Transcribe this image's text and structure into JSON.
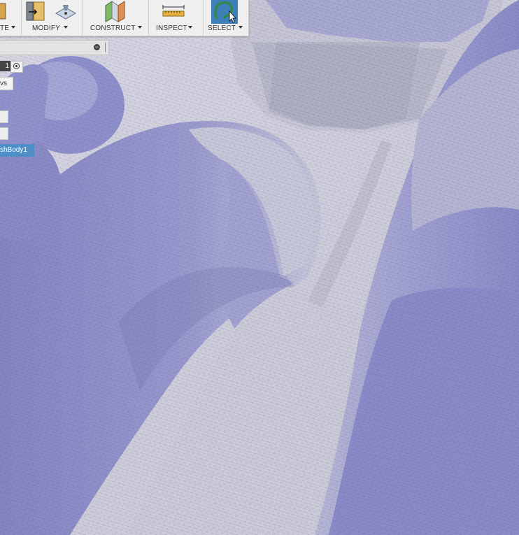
{
  "toolbar": {
    "groups": [
      {
        "label": "TE",
        "id": "create"
      },
      {
        "label": "MODIFY",
        "id": "modify"
      },
      {
        "label": "CONSTRUCT",
        "id": "construct"
      },
      {
        "label": "INSPECT",
        "id": "inspect"
      },
      {
        "label": "SELECT",
        "id": "select"
      }
    ]
  },
  "browser": {
    "row_number": "1",
    "views_label": "vs",
    "mesh_body_label": "shBody1"
  },
  "icons": [
    "modify-icon",
    "fill-icon",
    "construct-plane-icon",
    "measure-icon",
    "select-lasso-icon",
    "collapse-icon",
    "radio-icon"
  ],
  "colors": {
    "mesh_blue": "#8f90cc",
    "mesh_light": "#d0d0dd",
    "selection": "#4d8fc6",
    "toolbar_bg": "#efefef"
  }
}
